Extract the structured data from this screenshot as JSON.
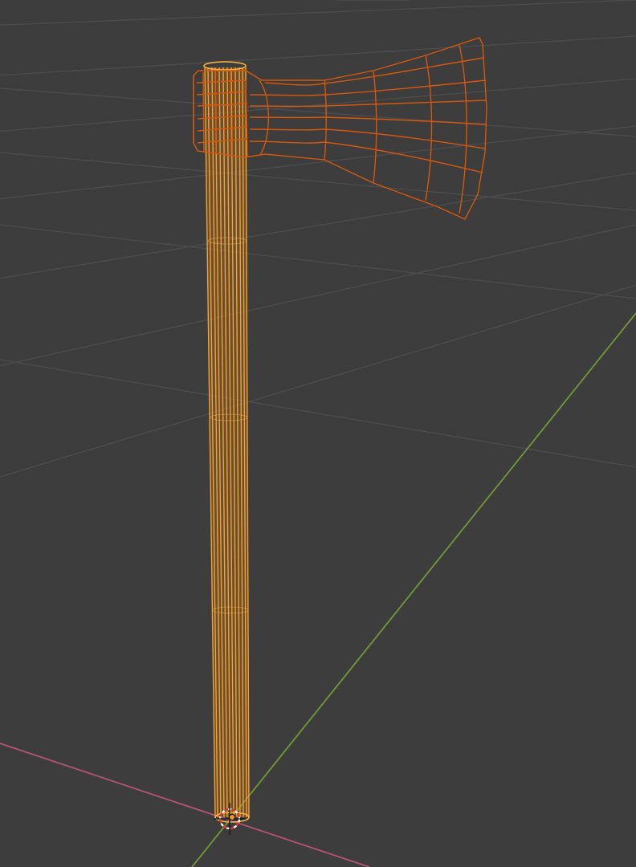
{
  "viewport": {
    "background": "#3d3d3d",
    "shading_mode": "wireframe"
  },
  "scene": {
    "grid": true,
    "grid_color": "#4e4e4e",
    "x_axis_color": "#b4546f",
    "y_axis_color": "#6f9a35",
    "object": {
      "kind": "axe",
      "handle_color": "#e48a1e",
      "handle_highlight": "#f7b23f",
      "head_color": "#d1570d",
      "selected": true
    },
    "origin_marker": "object-origin",
    "cursor_icon": "3d-cursor-icon"
  }
}
